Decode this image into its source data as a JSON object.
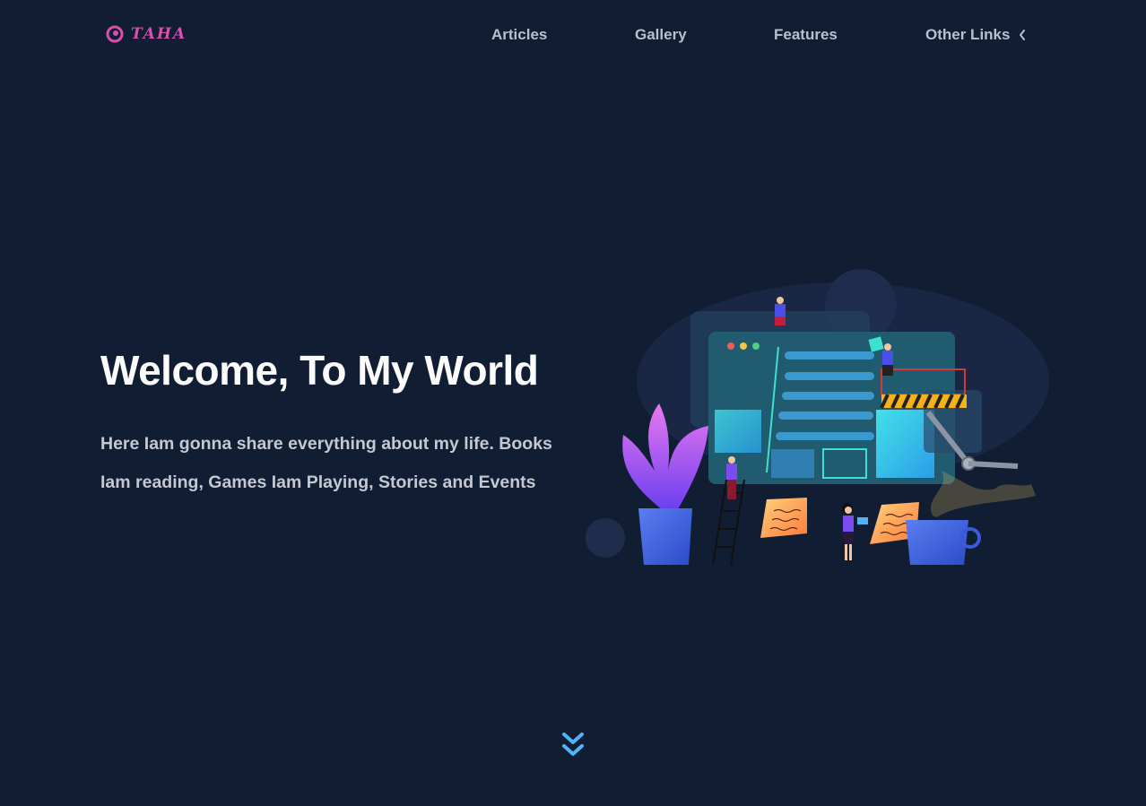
{
  "brand": {
    "name": "TAHA",
    "color": "#d84fb0"
  },
  "nav": {
    "articles": "Articles",
    "gallery": "Gallery",
    "features": "Features",
    "other_links": "Other Links",
    "other_links_icon": "chevron-left-icon"
  },
  "hero": {
    "title": "Welcome, To My World",
    "description": "Here Iam gonna share everything about my life. Books Iam reading, Games Iam Playing, Stories and Events"
  },
  "scroll_icon": "double-chevron-down-icon",
  "colors": {
    "background": "#111d33",
    "accent": "#4fb3f6",
    "nav_text": "#b9c0cd"
  }
}
